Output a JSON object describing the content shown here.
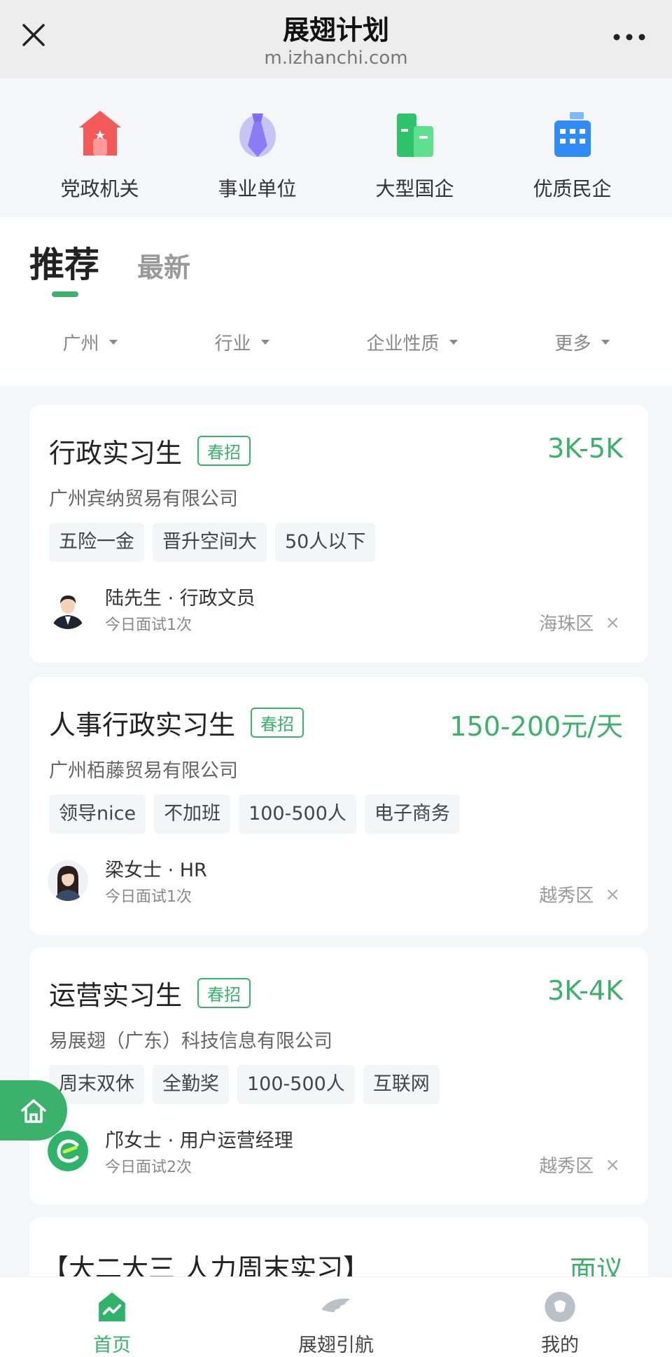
{
  "browser": {
    "title": "展翅计划",
    "url": "m.izhanchi.com"
  },
  "categories": [
    {
      "label": "党政机关",
      "icon": "government-building-icon"
    },
    {
      "label": "事业单位",
      "icon": "tie-icon"
    },
    {
      "label": "大型国企",
      "icon": "office-tower-icon"
    },
    {
      "label": "优质民企",
      "icon": "company-building-icon"
    }
  ],
  "tabs": {
    "recommended": "推荐",
    "latest": "最新"
  },
  "filters": [
    "广州",
    "行业",
    "企业性质",
    "更多"
  ],
  "jobs": [
    {
      "title": "行政实习生",
      "badge": "春招",
      "salary": "3K-5K",
      "company": "广州宾纳贸易有限公司",
      "tags": [
        "五险一金",
        "晋升空间大",
        "50人以下"
      ],
      "recruiter": "陆先生 · 行政文员",
      "interview": "今日面试1次",
      "district": "海珠区"
    },
    {
      "title": "人事行政实习生",
      "badge": "春招",
      "salary": "150-200元/天",
      "company": "广州栢藤贸易有限公司",
      "tags": [
        "领导nice",
        "不加班",
        "100-500人",
        "电子商务"
      ],
      "recruiter": "梁女士 · HR",
      "interview": "今日面试1次",
      "district": "越秀区"
    },
    {
      "title": "运营实习生",
      "badge": "春招",
      "salary": "3K-4K",
      "company": "易展翅（广东）科技信息有限公司",
      "tags": [
        "周末双休",
        "全勤奖",
        "100-500人",
        "互联网"
      ],
      "recruiter": "邝女士 · 用户运营经理",
      "interview": "今日面试2次",
      "district": "越秀区"
    },
    {
      "title": "【大二大三 人力周末实习】",
      "salary": "面议"
    }
  ],
  "dismiss_symbol": "×",
  "bottom_nav": [
    {
      "label": "首页",
      "active": true
    },
    {
      "label": "展翅引航",
      "active": false
    },
    {
      "label": "我的",
      "active": false
    }
  ],
  "colors": {
    "accent": "#3bb16b",
    "background": "#f5f6f8"
  }
}
